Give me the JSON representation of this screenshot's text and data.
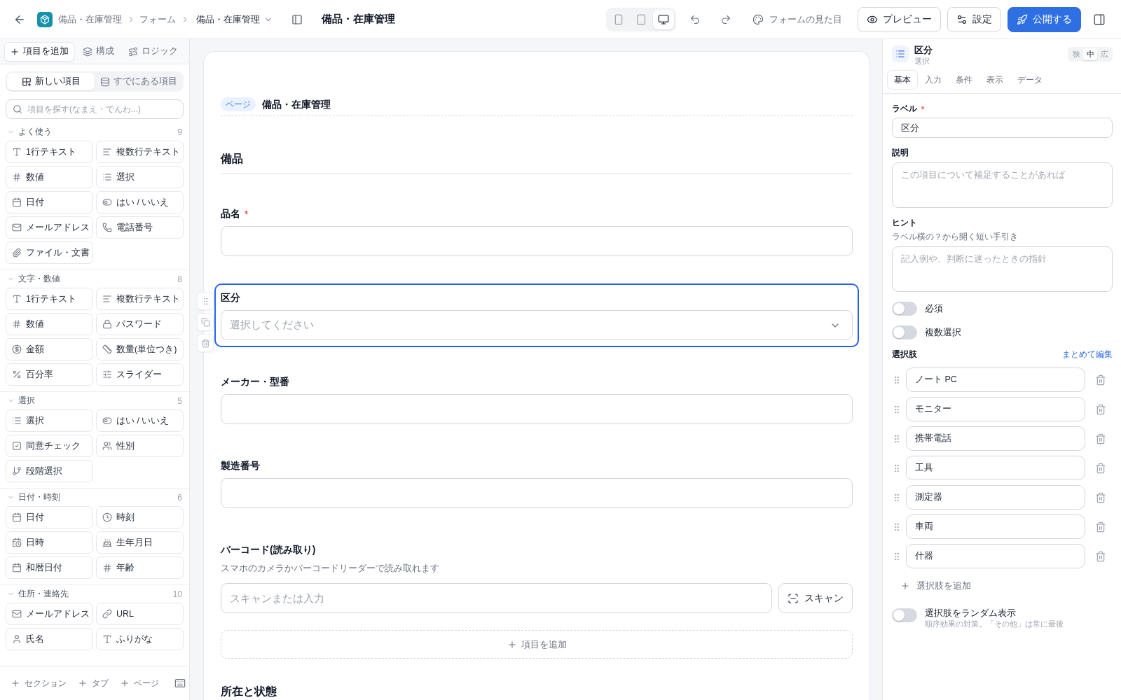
{
  "top_bar": {
    "breadcrumb": [
      "備品・在庫管理",
      "フォーム"
    ],
    "form_menu": "備品・在庫管理",
    "title": "備品・在庫管理",
    "devices": [
      {
        "kind": "phone",
        "selected": false
      },
      {
        "kind": "tablet",
        "selected": false
      },
      {
        "kind": "desktop",
        "selected": true
      }
    ],
    "appearance": "フォームの見た目",
    "preview": "プレビュー",
    "settings": "設定",
    "publish": "公開する"
  },
  "sidebar": {
    "tabs": [
      {
        "kind": "add",
        "label": "項目を追加",
        "selected": true
      },
      {
        "kind": "structure",
        "label": "構成",
        "selected": false
      },
      {
        "kind": "logic",
        "label": "ロジック",
        "selected": false
      }
    ],
    "modes": [
      {
        "kind": "new",
        "label": "新しい項目",
        "selected": true
      },
      {
        "kind": "existing",
        "label": "すでにある項目",
        "selected": false
      }
    ],
    "search": {
      "placeholder": "項目を探す(なまえ・でんわ...)"
    },
    "groups": [
      {
        "title": "よく使う",
        "count": "9",
        "items": [
          {
            "kind": "text",
            "label": "1行テキスト"
          },
          {
            "kind": "paragraph",
            "label": "複数行テキスト"
          },
          {
            "kind": "number",
            "label": "数値"
          },
          {
            "kind": "choice",
            "label": "選択"
          },
          {
            "kind": "date",
            "label": "日付"
          },
          {
            "kind": "yesno",
            "label": "はい / いいえ"
          },
          {
            "kind": "email",
            "label": "メールアドレス"
          },
          {
            "kind": "phone",
            "label": "電話番号"
          },
          {
            "kind": "file",
            "label": "ファイル・文書"
          }
        ]
      },
      {
        "title": "文字・数値",
        "count": "8",
        "items": [
          {
            "kind": "text",
            "label": "1行テキスト"
          },
          {
            "kind": "paragraph",
            "label": "複数行テキスト"
          },
          {
            "kind": "number",
            "label": "数値"
          },
          {
            "kind": "password",
            "label": "パスワード"
          },
          {
            "kind": "money",
            "label": "金額"
          },
          {
            "kind": "quantity",
            "label": "数量(単位つき)"
          },
          {
            "kind": "percent",
            "label": "百分率"
          },
          {
            "kind": "slider",
            "label": "スライダー"
          }
        ]
      },
      {
        "title": "選択",
        "count": "5",
        "items": [
          {
            "kind": "choice",
            "label": "選択"
          },
          {
            "kind": "yesno",
            "label": "はい / いいえ"
          },
          {
            "kind": "consent",
            "label": "同意チェック"
          },
          {
            "kind": "gender",
            "label": "性別"
          },
          {
            "kind": "cascade",
            "label": "段階選択"
          }
        ]
      },
      {
        "title": "日付・時刻",
        "count": "6",
        "items": [
          {
            "kind": "date",
            "label": "日付"
          },
          {
            "kind": "time",
            "label": "時刻"
          },
          {
            "kind": "datetime",
            "label": "日時"
          },
          {
            "kind": "birthday",
            "label": "生年月日"
          },
          {
            "kind": "wareki",
            "label": "和暦日付"
          },
          {
            "kind": "age",
            "label": "年齢"
          }
        ]
      },
      {
        "title": "住所・連絡先",
        "count": "10",
        "items": [
          {
            "kind": "email",
            "label": "メールアドレス"
          },
          {
            "kind": "url",
            "label": "URL"
          },
          {
            "kind": "name",
            "label": "氏名"
          },
          {
            "kind": "kana",
            "label": "ふりがな"
          }
        ]
      }
    ],
    "footer": [
      "セクション",
      "タブ",
      "ページ"
    ]
  },
  "form": {
    "page_tag": "ページ",
    "page_title": "備品・在庫管理",
    "sections": [
      {
        "title": "備品",
        "fields": [
          {
            "kind": "text",
            "label": "品名",
            "required": true,
            "selected": false
          },
          {
            "kind": "select",
            "label": "区分",
            "required": false,
            "selected": true,
            "placeholder": "選択してください"
          },
          {
            "kind": "text",
            "label": "メーカー・型番",
            "required": false,
            "selected": false
          },
          {
            "kind": "text",
            "label": "製造番号",
            "required": false,
            "selected": false
          },
          {
            "kind": "scan",
            "label": "バーコード(読み取り)",
            "required": false,
            "selected": false,
            "help": "スマホのカメラかバーコードリーダーで読み取れます",
            "placeholder": "スキャンまたは入力",
            "button": "スキャン"
          }
        ],
        "add_label": "項目を追加"
      },
      {
        "title": "所在と状態"
      }
    ]
  },
  "inspector": {
    "title": "区分",
    "type": "選択",
    "widths": [
      {
        "label": "狭",
        "selected": false
      },
      {
        "label": "中",
        "selected": true
      },
      {
        "label": "広",
        "selected": false
      }
    ],
    "tabs": [
      {
        "label": "基本",
        "selected": true
      },
      {
        "label": "入力",
        "selected": false
      },
      {
        "label": "条件",
        "selected": false
      },
      {
        "label": "表示",
        "selected": false
      },
      {
        "label": "データ",
        "selected": false
      }
    ],
    "label_field": {
      "label": "ラベル",
      "required": true,
      "value": "区分"
    },
    "description_field": {
      "label": "説明",
      "placeholder": "この項目について補足することがあれば"
    },
    "hint_field": {
      "label": "ヒント",
      "help": "ラベル横の？から開く短い手引き",
      "placeholder": "記入例や、判断に迷ったときの指針"
    },
    "toggles": [
      {
        "label": "必須",
        "on": false
      },
      {
        "label": "複数選択",
        "on": false
      }
    ],
    "options": {
      "title": "選択肢",
      "edit_link": "まとめて編集",
      "items": [
        "ノート PC",
        "モニター",
        "携帯電話",
        "工具",
        "測定器",
        "車両",
        "什器"
      ],
      "add_label": "選択肢を追加"
    },
    "shuffle": {
      "label": "選択肢をランダム表示",
      "description": "順序効果の対策。「その他」は常に最後",
      "on": false
    }
  }
}
